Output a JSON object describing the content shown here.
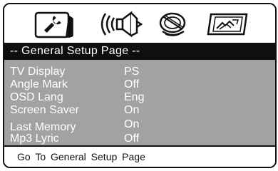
{
  "tabs": [
    {
      "icon": "general-setup-icon",
      "selected": true
    },
    {
      "icon": "audio-speaker-icon",
      "selected": false
    },
    {
      "icon": "video-disc-icon",
      "selected": false
    },
    {
      "icon": "preference-picture-icon",
      "selected": false
    }
  ],
  "header": {
    "title": "-- General  Setup  Page --"
  },
  "menu": {
    "items": [
      {
        "label": "TV Display",
        "value": "PS"
      },
      {
        "label": "Angle Mark",
        "value": "Off"
      },
      {
        "label": "OSD Lang",
        "value": "Eng"
      },
      {
        "label": "Screen Saver",
        "value": "On"
      },
      {
        "label": "Last Memory",
        "value": "On"
      },
      {
        "label": "Mp3 Lyric",
        "value": "Off"
      }
    ]
  },
  "status": {
    "text": "Go  To  General  Setup  Page"
  },
  "colors": {
    "header_bg": "#0f0f0f",
    "menu_bg": "#a2a2a2",
    "text_light": "#ffffff",
    "text_dark": "#111111"
  }
}
